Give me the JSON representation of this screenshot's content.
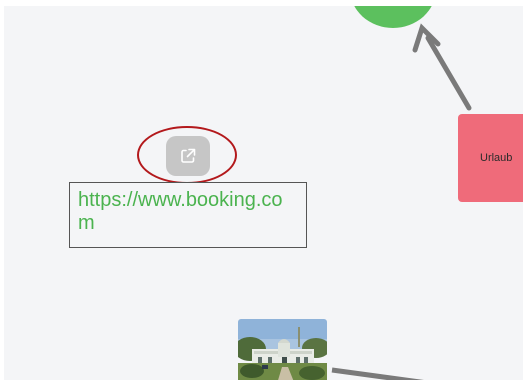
{
  "canvas": {
    "background": "#f4f5f7"
  },
  "nodes": {
    "green_node": {
      "color": "#5cc05e"
    },
    "red_node": {
      "label": "Urlaub",
      "color": "#ef6b7a"
    },
    "link_node": {
      "open_button_icon": "external-link-icon",
      "url": "https://www.booking.com",
      "url_color": "#4bb34f"
    },
    "image_node": {
      "image": "building-photo"
    }
  },
  "annotations": {
    "highlight_color": "#b3191c"
  },
  "connectors": {
    "color": "#7a7a7a"
  }
}
